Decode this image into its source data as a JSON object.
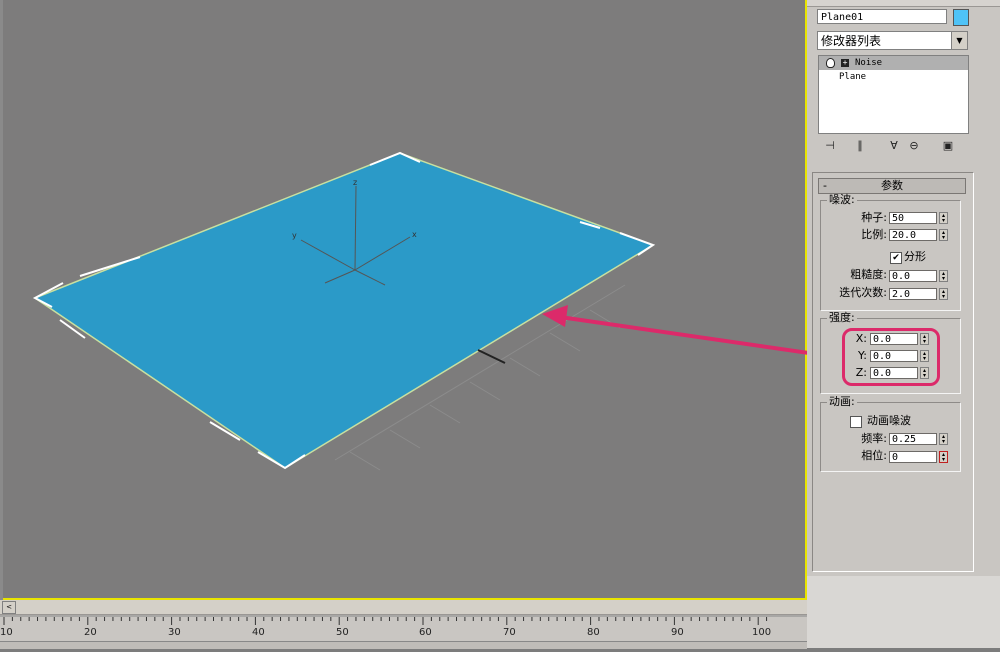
{
  "object": {
    "name": "Plane01",
    "color": "#4fc3f7"
  },
  "modifier_list": {
    "label": "修改器列表"
  },
  "stack": [
    {
      "label": "Noise",
      "selected": true
    },
    {
      "label": "Plane",
      "selected": false
    }
  ],
  "rollout": {
    "minus": "-",
    "title": "参数"
  },
  "noise": {
    "group": "噪波:",
    "seed_label": "种子:",
    "seed": "50",
    "scale_label": "比例:",
    "scale": "20.0",
    "fractal_label": "分形",
    "fractal_checked": true,
    "roughness_label": "粗糙度:",
    "roughness": "0.0",
    "iterations_label": "迭代次数:",
    "iterations": "2.0"
  },
  "strength": {
    "group": "强度:",
    "x_label": "X:",
    "x": "0.0",
    "y_label": "Y:",
    "y": "0.0",
    "z_label": "Z:",
    "z": "0.0"
  },
  "animation": {
    "group": "动画:",
    "animate_label": "动画噪波",
    "animate_checked": false,
    "freq_label": "频率:",
    "freq": "0.25",
    "phase_label": "相位:",
    "phase": "0"
  },
  "viewport": {
    "axis_x": "x",
    "axis_y": "y",
    "axis_z": "z",
    "plane_color": "#2b9ac8",
    "highlight_color": "#dc2a6a"
  },
  "timeline": {
    "ticks": [
      "10",
      "20",
      "30",
      "40",
      "50",
      "60",
      "70",
      "80",
      "90",
      "100"
    ],
    "scroll_left": "<"
  }
}
